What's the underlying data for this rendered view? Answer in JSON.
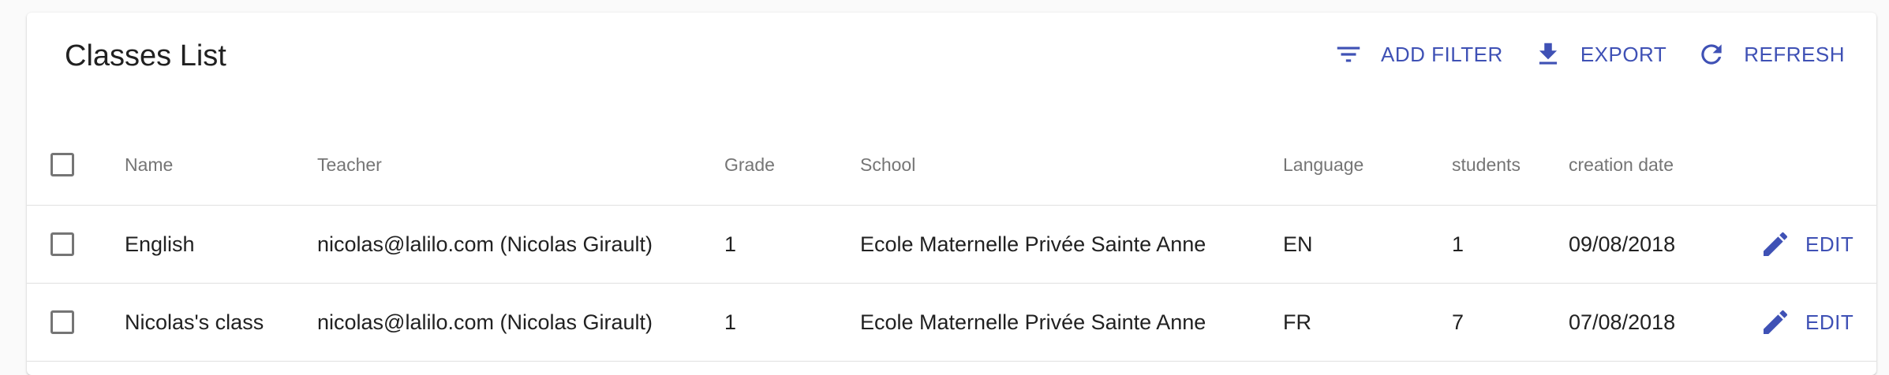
{
  "page": {
    "title": "Classes List"
  },
  "toolbar": {
    "add_filter": {
      "label": "ADD FILTER",
      "icon": "filter-list-icon"
    },
    "export": {
      "label": "EXPORT",
      "icon": "download-icon"
    },
    "refresh": {
      "label": "REFRESH",
      "icon": "refresh-icon"
    }
  },
  "table": {
    "columns": [
      "Name",
      "Teacher",
      "Grade",
      "School",
      "Language",
      "students",
      "creation date"
    ],
    "rows": [
      {
        "name": "English",
        "teacher": "nicolas@lalilo.com (Nicolas Girault)",
        "grade": "1",
        "school": "Ecole Maternelle Privée Sainte Anne",
        "language": "EN",
        "students": "1",
        "creation_date": "09/08/2018",
        "edit_label": "EDIT"
      },
      {
        "name": "Nicolas's class",
        "teacher": "nicolas@lalilo.com (Nicolas Girault)",
        "grade": "1",
        "school": "Ecole Maternelle Privée Sainte Anne",
        "language": "FR",
        "students": "7",
        "creation_date": "07/08/2018",
        "edit_label": "EDIT"
      }
    ]
  },
  "colors": {
    "accent": "#3f51b5",
    "text": "#212121",
    "muted": "#757575",
    "divider": "#e0e0e0"
  }
}
